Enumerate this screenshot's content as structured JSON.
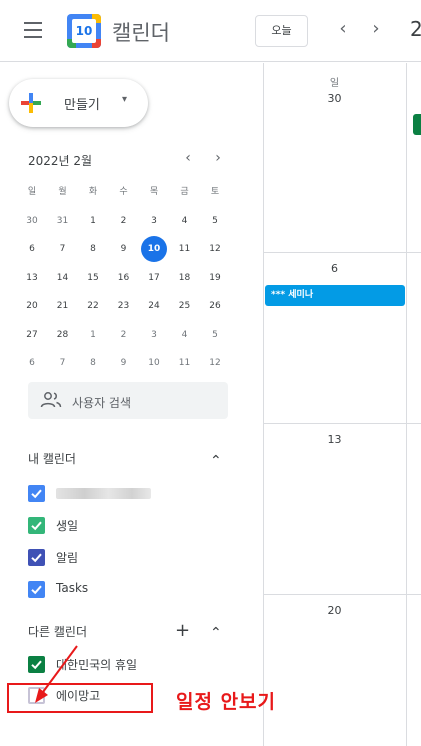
{
  "header": {
    "menu_icon": "hamburger-menu-icon",
    "logo_day": "10",
    "app_title": "캘린더",
    "today_button": "오늘",
    "prev_icon": "chevron-left-icon",
    "prev_glyph": "‹",
    "next_icon": "chevron-right-icon",
    "next_glyph": "›",
    "range_text": "2"
  },
  "sidebar": {
    "create_button": "만들기",
    "create_caret": "▾",
    "mini_calendar": {
      "title": "2022년 2월",
      "prev_glyph": "‹",
      "next_glyph": "›",
      "weekdays": [
        "일",
        "월",
        "화",
        "수",
        "목",
        "금",
        "토"
      ],
      "weeks": [
        [
          "30",
          "31",
          "1",
          "2",
          "3",
          "4",
          "5"
        ],
        [
          "6",
          "7",
          "8",
          "9",
          "10",
          "11",
          "12"
        ],
        [
          "13",
          "14",
          "15",
          "16",
          "17",
          "18",
          "19"
        ],
        [
          "20",
          "21",
          "22",
          "23",
          "24",
          "25",
          "26"
        ],
        [
          "27",
          "28",
          "1",
          "2",
          "3",
          "4",
          "5"
        ],
        [
          "6",
          "7",
          "8",
          "9",
          "10",
          "11",
          "12"
        ]
      ],
      "today": "10"
    },
    "people_search": "사용자 검색",
    "my_calendars": {
      "title": "내 캘린더",
      "toggle_glyph": "⌃",
      "items": [
        {
          "label": "",
          "color": "#4285f4",
          "checked": true
        },
        {
          "label": "생일",
          "color": "#33b679",
          "checked": true
        },
        {
          "label": "알림",
          "color": "#3f51b5",
          "checked": true
        },
        {
          "label": "Tasks",
          "color": "#4285f4",
          "checked": true
        }
      ]
    },
    "other_calendars": {
      "title": "다른 캘린더",
      "add_glyph": "+",
      "toggle_glyph": "⌃",
      "items": [
        {
          "label": "대한민국의 휴일",
          "color": "#0b8043",
          "checked": true
        },
        {
          "label": "에이망고",
          "color": "#c7c3d6",
          "checked": false
        }
      ]
    }
  },
  "grid": {
    "days": [
      {
        "dow": "일",
        "num": "30"
      },
      {
        "dow": "",
        "num": "6"
      },
      {
        "dow": "",
        "num": "13"
      },
      {
        "dow": "",
        "num": "20"
      }
    ],
    "event_label": "*** 세미나",
    "event_color": "#039be5"
  },
  "annotation": {
    "text": "일정 안보기",
    "color": "#e8191a"
  }
}
